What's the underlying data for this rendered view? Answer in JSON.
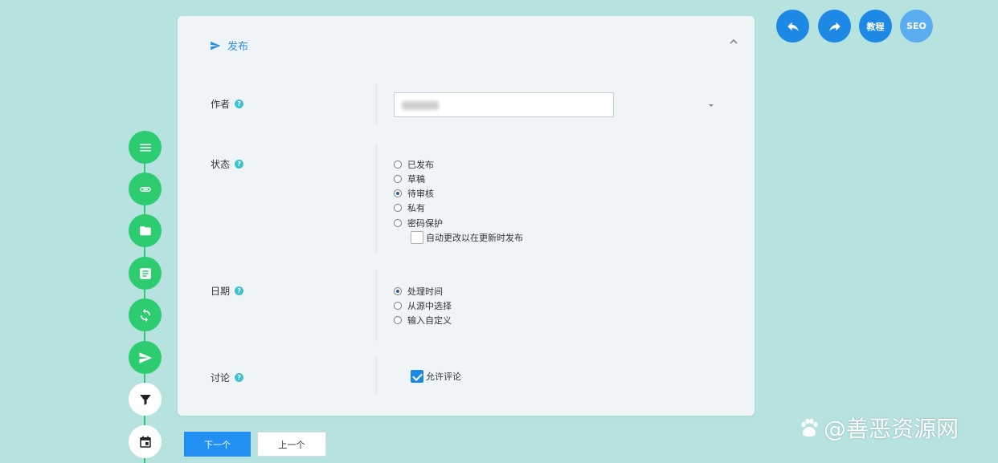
{
  "colors": {
    "accent": "#1e88e5",
    "step_green": "#2ecc71",
    "help_teal": "#3cc1cf",
    "background": "#b6e3e0"
  },
  "toolbar": {
    "undo_icon": "undo-icon",
    "redo_icon": "redo-icon",
    "tutorial_label": "教程",
    "seo_label": "SEO"
  },
  "section": {
    "title": "发布",
    "icon": "send-icon"
  },
  "author": {
    "label": "作者"
  },
  "status": {
    "label": "状态",
    "options": [
      "已发布",
      "草稿",
      "待审核",
      "私有",
      "密码保护"
    ],
    "selected": "待审核",
    "auto_change_label": "自动更改以在更新时发布"
  },
  "date": {
    "label": "日期",
    "options": [
      "处理时间",
      "从源中选择",
      "输入自定义"
    ],
    "selected": "处理时间"
  },
  "discussion": {
    "label": "讨论",
    "allow_comments_label": "允许评论",
    "allow_comments_checked": true
  },
  "steps": [
    "menu-icon",
    "link-icon",
    "folder-icon",
    "article-icon",
    "sync-icon",
    "send-icon",
    "filter-icon",
    "calendar-icon"
  ],
  "buttons": {
    "next_label": "下一个",
    "prev_label": "上一个"
  },
  "watermark": {
    "text": "@善恶资源网"
  }
}
